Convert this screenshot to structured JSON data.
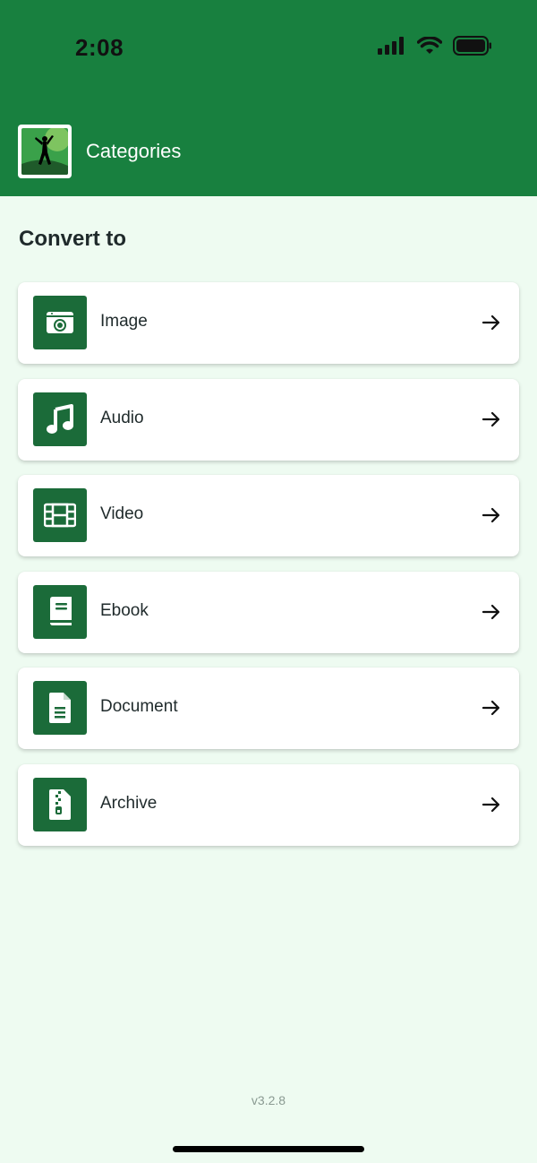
{
  "status_bar": {
    "time": "2:08"
  },
  "header": {
    "title": "Categories",
    "logo_icon": "app-logo-icon"
  },
  "section": {
    "title": "Convert to"
  },
  "categories": [
    {
      "label": "Image",
      "icon": "image-icon"
    },
    {
      "label": "Audio",
      "icon": "music-note-icon"
    },
    {
      "label": "Video",
      "icon": "film-icon"
    },
    {
      "label": "Ebook",
      "icon": "book-icon"
    },
    {
      "label": "Document",
      "icon": "document-icon"
    },
    {
      "label": "Archive",
      "icon": "archive-file-icon"
    }
  ],
  "footer": {
    "version": "v3.2.8"
  },
  "colors": {
    "primary": "#18803f",
    "icon_bg": "#1b6b39",
    "background": "#eefbf1"
  }
}
